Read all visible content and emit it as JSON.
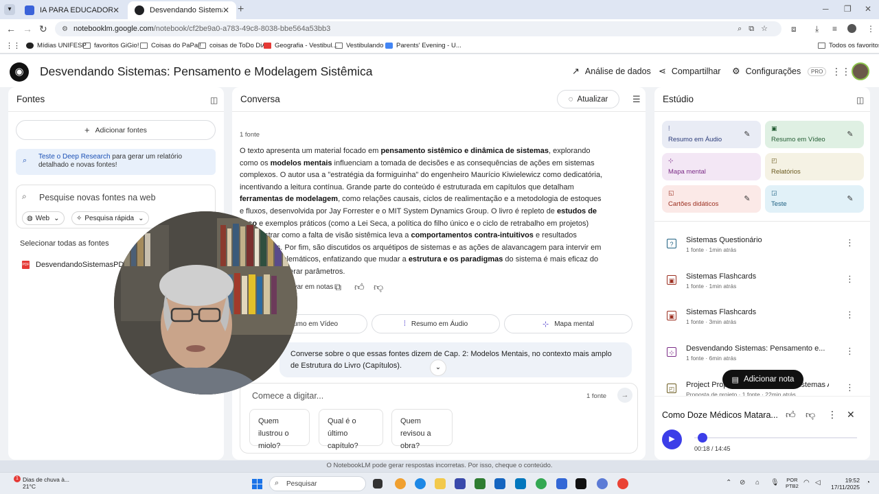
{
  "browser": {
    "tabs": [
      {
        "label": "IA PARA EDUCADORES",
        "close": "✕",
        "color": "#3b63d9"
      },
      {
        "label": "Desvendando Sistemas: Pensam",
        "close": "✕",
        "color": "#202124"
      }
    ],
    "new_tab": "+",
    "url_host": "notebooklm.google.com",
    "url_path": "/notebook/cf2be9a0-a783-49c8-8038-bbe564a53bb3",
    "bookmarks": [
      {
        "label": "Mídias UNIFESP",
        "icon": "dark"
      },
      {
        "label": "favoritos GiGio!",
        "icon": "folder"
      },
      {
        "label": "Coisas do PaPai!",
        "icon": "folder"
      },
      {
        "label": "coisas de ToDo DiA",
        "icon": "folder"
      },
      {
        "label": "Geografia - Vestibul...",
        "icon": "red"
      },
      {
        "label": "Vestibulando",
        "icon": "folder"
      },
      {
        "label": "Parents' Evening - U...",
        "icon": "blue"
      }
    ],
    "all_favorites": "Todos os favoritos"
  },
  "header": {
    "title": "Desvendando Sistemas: Pensamento e Modelagem Sistêmica",
    "analytics": "Análise de dados",
    "share": "Compartilhar",
    "settings": "Configurações",
    "pro_badge": "PRO"
  },
  "sources": {
    "title": "Fontes",
    "add_label": "Adicionar fontes",
    "deep_link": "Teste o Deep Research",
    "deep_text": " para gerar um relatório detalhado e novas fontes!",
    "search_placeholder": "Pesquise novas fontes na web",
    "web_chip": "Web",
    "fast_chip": "Pesquisa rápida",
    "select_all": "Selecionar todas as fontes",
    "file": "DesvendandoSistemasPDF.pdf"
  },
  "chat": {
    "title": "Conversa",
    "refresh": "Atualizar",
    "source_count": "1 fonte",
    "save_notes": "Salvar em notas",
    "suggestions": [
      "Resumo em Vídeo",
      "Resumo em Áudio",
      "Mapa mental"
    ],
    "user_message": "Converse sobre o que essas fontes dizem de Cap. 2: Modelos Mentais, no contexto mais amplo de Estrutura do Livro (Capítulos).",
    "input_placeholder": "Comece a digitar...",
    "input_count": "1 fonte",
    "quick_questions": [
      "Quem ilustrou o miolo?",
      "Qual é o último capítulo?",
      "Quem revisou a obra?"
    ]
  },
  "studio": {
    "title": "Estúdio",
    "tiles": [
      {
        "label": "Resumo em Áudio",
        "bg": "#e9ecf5",
        "fg": "#2a3a78",
        "edit": true
      },
      {
        "label": "Resumo em Vídeo",
        "bg": "#dff0e3",
        "fg": "#235c33",
        "edit": true
      },
      {
        "label": "Mapa mental",
        "bg": "#f3e7f5",
        "fg": "#7a2a86",
        "edit": false
      },
      {
        "label": "Relatórios",
        "bg": "#f5f2e4",
        "fg": "#6a5a1f",
        "edit": false
      },
      {
        "label": "Cartões didáticos",
        "bg": "#fbe9e7",
        "fg": "#9b2e1f",
        "edit": true
      },
      {
        "label": "Teste",
        "bg": "#e1f1f8",
        "fg": "#1c5f80",
        "edit": true
      }
    ],
    "notes": [
      {
        "title": "Sistemas Questionário",
        "meta": "1 fonte · 1min atrás",
        "icon": "quiz",
        "color": "#1c5f80"
      },
      {
        "title": "Sistemas Flashcards",
        "meta": "1 fonte · 1min atrás",
        "icon": "flashcards",
        "color": "#9b2e1f"
      },
      {
        "title": "Sistemas Flashcards",
        "meta": "1 fonte · 3min atrás",
        "icon": "flashcards",
        "color": "#9b2e1f"
      },
      {
        "title": "Desvendando Sistemas: Pensamento e...",
        "meta": "1 fonte · 6min atrás",
        "icon": "mindmap",
        "color": "#7a2a86"
      },
      {
        "title": "Project Proposal: Desvendando Sistemas Attention...",
        "meta": "Proposta de projeto · 1 fonte · 22min atrás",
        "icon": "report",
        "color": "#6a5a1f"
      }
    ],
    "add_note": "Adicionar nota",
    "player_title": "Como Doze Médicos Matara...",
    "player_time": "00:18 / 14:45",
    "player_progress": 0.02
  },
  "disclaimer": "O NotebookLM pode gerar respostas incorretas. Por isso, cheque o conteúdo.",
  "taskbar": {
    "weather_line1": "Dias de chuva à...",
    "weather_line2": "21°C",
    "weather_badge": "1",
    "search": "Pesquisar",
    "lang_line1": "POR",
    "lang_line2": "PTB2",
    "time": "19:52",
    "date": "17/11/2025"
  }
}
